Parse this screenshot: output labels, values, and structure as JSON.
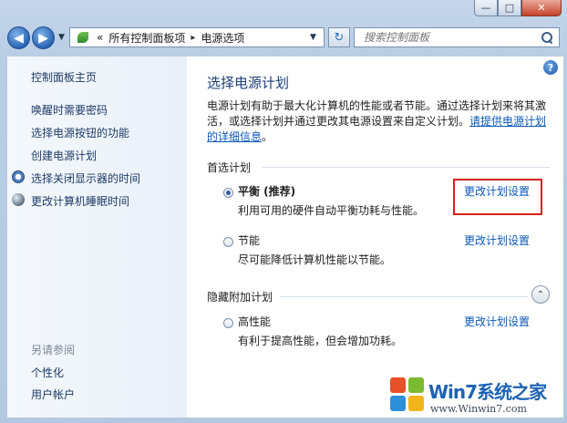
{
  "window": {
    "minimize": "—",
    "maximize": "□",
    "close": "✕"
  },
  "nav": {
    "back_icon": "back-arrow-icon",
    "forward_icon": "forward-arrow-icon",
    "breadcrumb_prefix": "«",
    "breadcrumb": [
      "所有控制面板项",
      "电源选项"
    ],
    "breadcrumb_sep": "▸",
    "refresh_symbol": "↻",
    "search_placeholder": "搜索控制面板"
  },
  "sidebar": {
    "home": "控制面板主页",
    "items": [
      {
        "label": "唤醒时需要密码"
      },
      {
        "label": "选择电源按钮的功能"
      },
      {
        "label": "创建电源计划"
      },
      {
        "label": "选择关闭显示器的时间",
        "icon": "clock-icon"
      },
      {
        "label": "更改计算机睡眠时间",
        "icon": "moon-icon"
      }
    ],
    "see_also": "另请参阅",
    "see_also_items": [
      {
        "label": "个性化"
      },
      {
        "label": "用户帐户"
      }
    ]
  },
  "main": {
    "help": "?",
    "title": "选择电源计划",
    "description": "电源计划有助于最大化计算机的性能或者节能。通过选择计划来将其激活，或选择计划并通过更改其电源设置来自定义计划。",
    "description_link": "请提供电源计划的详细信息",
    "description_end": "。",
    "preferred_label": "首选计划",
    "hidden_label": "隐藏附加计划",
    "collapse_symbol": "⌃",
    "plans": [
      {
        "name": "平衡 (推荐)",
        "desc": "利用可用的硬件自动平衡功耗与性能。",
        "link": "更改计划设置",
        "checked": true
      },
      {
        "name": "节能",
        "desc": "尽可能降低计算机性能以节能。",
        "link": "更改计划设置",
        "checked": false
      },
      {
        "name": "高性能",
        "desc": "有利于提高性能，但会增加功耗。",
        "link": "更改计划设置",
        "checked": false
      }
    ]
  },
  "watermark": {
    "brand": "Win7系统之家",
    "url": "www.Winwin7.com"
  },
  "colors": {
    "link": "#0b58b8",
    "title": "#1e3d78",
    "highlight": "#d62020"
  }
}
